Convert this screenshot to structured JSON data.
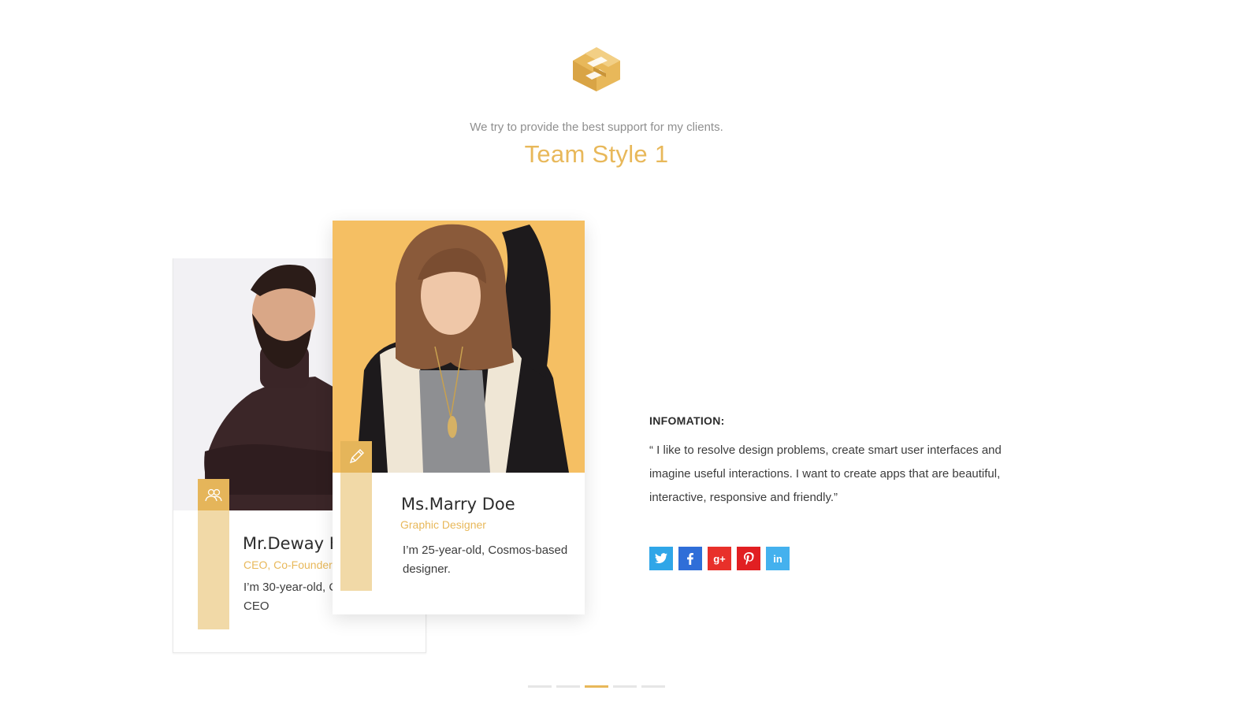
{
  "header": {
    "subtitle": "We try to provide the best support for my clients.",
    "title": "Team Style 1"
  },
  "colors": {
    "accent": "#e8b85a",
    "accent_light": "#f1d9a7",
    "twitter": "#2fa6e8",
    "facebook": "#2f6ed8",
    "google_plus": "#e8302a",
    "pinterest": "#e11f22",
    "linkedin": "#44b1ee"
  },
  "team": [
    {
      "name": "Mr.Deway H",
      "role": "CEO, Co-Founder",
      "bio_line1": "I’m 30-year-old, C",
      "bio_line2": "CEO",
      "icon": "users-icon"
    },
    {
      "name": "Ms.Marry Doe",
      "role": "Graphic Designer",
      "bio_line1": "I’m 25-year-old, Cosmos-based",
      "bio_line2": "designer.",
      "icon": "pencil-icon"
    }
  ],
  "info": {
    "heading": "INFOMATION:",
    "quote": "“ I like to resolve design problems, create smart user interfaces and imagine useful interactions. I want to create apps that are beautiful, interactive, responsive and friendly.”"
  },
  "socials": [
    {
      "label": "t",
      "icon": "twitter-icon"
    },
    {
      "label": "f",
      "icon": "facebook-icon"
    },
    {
      "label": "g+",
      "icon": "google-plus-icon"
    },
    {
      "label": "P",
      "icon": "pinterest-icon"
    },
    {
      "label": "in",
      "icon": "linkedin-icon"
    }
  ],
  "pagination": {
    "count": 5,
    "active": 3
  }
}
